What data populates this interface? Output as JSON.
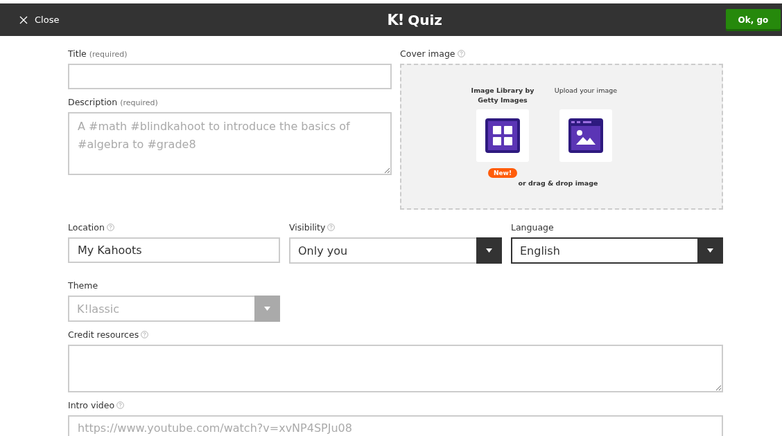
{
  "top_bar": {
    "close_label": "Close",
    "logo": "K!",
    "title": "Quiz",
    "confirm_button": "Ok, go"
  },
  "left_fields": [
    {
      "kind": "text",
      "label": "Title",
      "hint": "(required)",
      "help": false
    },
    {
      "kind": "textarea",
      "label": "Description",
      "hint": "(required)",
      "help": false,
      "placeholder": "A #math #blindkahoot to introduce the basics of #algebra to #grade8"
    }
  ],
  "cover_image": {
    "label": "Cover image",
    "help": true,
    "options": [
      {
        "kind": "library",
        "label": "Image Library by Getty Images",
        "badge": "New!"
      },
      {
        "kind": "upload",
        "label": "Upload your image"
      }
    ],
    "drop_hint": "or drag & drop image"
  },
  "settings_fields": [
    {
      "kind": "text",
      "label": "Location",
      "help": true,
      "value": "My Kahoots"
    },
    {
      "kind": "select",
      "label": "Visibility",
      "help": true,
      "value": "Only you",
      "disabled": false,
      "focused": false
    },
    {
      "kind": "select",
      "label": "Language",
      "help": false,
      "value": "English",
      "disabled": false,
      "focused": true
    },
    {
      "kind": "select",
      "label": "Theme",
      "help": false,
      "value": "K!lassic",
      "disabled": true,
      "focused": false
    }
  ],
  "bottom_fields": [
    {
      "kind": "textarea",
      "label": "Credit resources",
      "help": true
    },
    {
      "kind": "text",
      "label": "Intro video",
      "help": true,
      "placeholder": "https://www.youtube.com/watch?v=xvNP4SPJu08"
    }
  ]
}
